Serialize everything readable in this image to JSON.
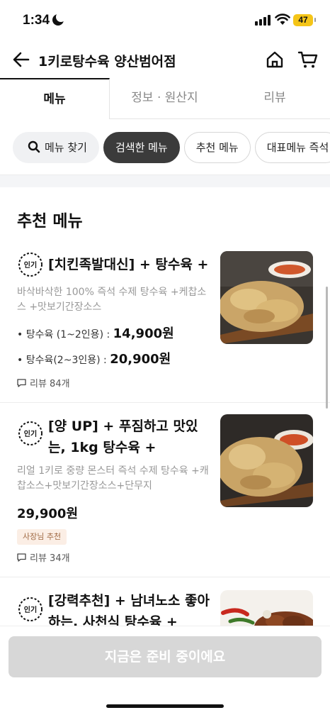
{
  "status_bar": {
    "time": "1:34",
    "battery": "47"
  },
  "header": {
    "title": "1키로탕수육 양산범어점"
  },
  "tabs": [
    {
      "label": "메뉴"
    },
    {
      "label": "정보 · 원산지"
    },
    {
      "label": "리뷰"
    }
  ],
  "chips": {
    "search_label": "메뉴 찾기",
    "items": [
      "검색한 메뉴",
      "추천 메뉴",
      "대표메뉴 즉석"
    ]
  },
  "section": {
    "title": "추천 메뉴"
  },
  "popular_badge": "인기",
  "menu_items": [
    {
      "name": "[치킨족발대신] + 탕수육 +",
      "description": "바삭바삭한  100% 즉석 수제 탕수육 +케찹소스 +맛보기간장소스",
      "options": [
        {
          "label": "• 탕수육 (1~2인용) : ",
          "price": "14,900원"
        },
        {
          "label": "• 탕수육(2~3인용) : ",
          "price": "20,900원"
        }
      ],
      "review": "리뷰 84개"
    },
    {
      "name": "[양 UP] + 푸짐하고 맛있는, 1kg 탕수육 +",
      "description": "리얼 1키로 중량 몬스터 즉석 수제 탕수육 +캐찹소스+맛보기간장소스+단무지",
      "price": "29,900원",
      "badge": "사장님 추천",
      "review": "리뷰 34개"
    },
    {
      "name": "[강력추천] + 남녀노소 좋아하는, 사천식 탕수육 +"
    }
  ],
  "bottom": {
    "button_label": "지금은 준비 중이에요"
  },
  "colors": {
    "badge_bg": "#fbeee5",
    "badge_text": "#a06a44",
    "selected_chip": "#3b3b3b",
    "disabled_button": "#d7d7d7"
  }
}
